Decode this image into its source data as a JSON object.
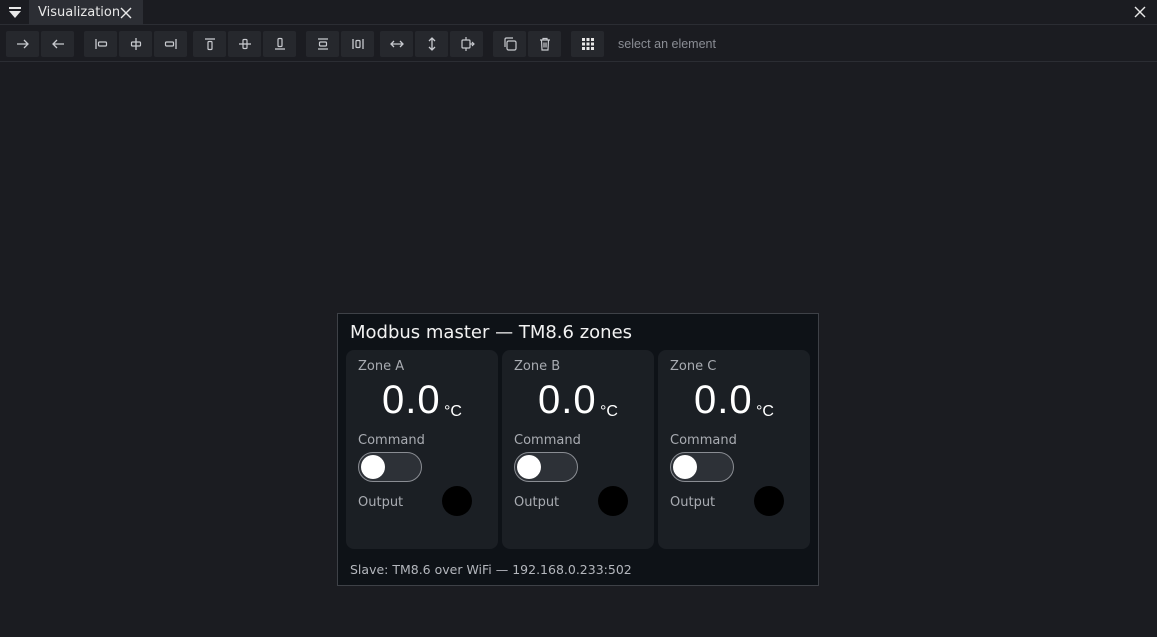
{
  "tabbar": {
    "tab_title": "Visualization"
  },
  "toolbar": {
    "buttons": [
      {
        "name": "arrow-right-icon"
      },
      {
        "name": "arrow-left-icon"
      },
      {
        "name": "align-left-icon"
      },
      {
        "name": "align-center-horizontal-icon"
      },
      {
        "name": "align-right-icon"
      },
      {
        "name": "align-top-icon"
      },
      {
        "name": "align-middle-vertical-icon"
      },
      {
        "name": "align-bottom-icon"
      },
      {
        "name": "distribute-vertical-icon"
      },
      {
        "name": "distribute-horizontal-icon"
      },
      {
        "name": "resize-width-icon"
      },
      {
        "name": "resize-height-icon"
      },
      {
        "name": "resize-both-icon"
      },
      {
        "name": "duplicate-icon"
      },
      {
        "name": "delete-icon"
      },
      {
        "name": "grid-icon"
      }
    ],
    "status": "select an element"
  },
  "panel": {
    "title": "Modbus master — TM8.6 zones",
    "zones": [
      {
        "name": "Zone A",
        "value": "0.0",
        "unit": "°C",
        "command_label": "Command",
        "command_on": false,
        "output_label": "Output",
        "output_color": "#000000"
      },
      {
        "name": "Zone B",
        "value": "0.0",
        "unit": "°C",
        "command_label": "Command",
        "command_on": false,
        "output_label": "Output",
        "output_color": "#000000"
      },
      {
        "name": "Zone C",
        "value": "0.0",
        "unit": "°C",
        "command_label": "Command",
        "command_on": false,
        "output_label": "Output",
        "output_color": "#000000"
      }
    ],
    "footer": "Slave: TM8.6 over WiFi — 192.168.0.233:502"
  }
}
